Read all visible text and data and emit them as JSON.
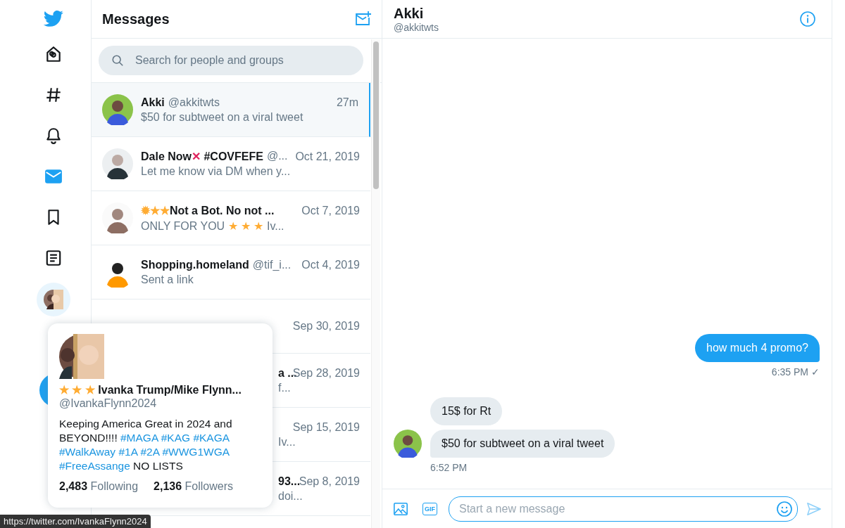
{
  "nav": {
    "items": [
      {
        "selected": false
      },
      {
        "selected": false
      },
      {
        "selected": false
      },
      {
        "selected": true
      },
      {
        "selected": false
      },
      {
        "selected": false
      }
    ]
  },
  "messages_panel": {
    "title": "Messages",
    "search": {
      "placeholder": "Search for people and groups"
    },
    "conversations": [
      {
        "kind": "full",
        "selected": true,
        "name": [
          {
            "text": "Akki"
          }
        ],
        "handle": "@akkitwts",
        "date": "27m",
        "preview": [
          {
            "text": "$50 for subtweet on a viral tweet"
          }
        ]
      },
      {
        "kind": "full",
        "selected": false,
        "name": [
          {
            "text": "Dale Now"
          },
          {
            "text": "✕",
            "color": "#e0245e"
          },
          {
            "text": " #COVFEFE"
          }
        ],
        "handle": "@...",
        "date": "Oct 21, 2019",
        "preview": [
          {
            "text": "Let me know via DM when y..."
          }
        ]
      },
      {
        "kind": "full",
        "selected": false,
        "name": [
          {
            "text": "✹★★",
            "color": "#ffac33"
          },
          {
            "text": "Not a Bot. No not ..."
          }
        ],
        "date": "Oct 7, 2019",
        "preview": [
          {
            "text": "ONLY FOR YOU "
          },
          {
            "text": "★ ★ ★",
            "color": "#ffac33"
          },
          {
            "text": " Iv..."
          }
        ]
      },
      {
        "kind": "full",
        "selected": false,
        "name": [
          {
            "text": "Shopping.homeland"
          }
        ],
        "handle": "@tif_i...",
        "date": "Oct 4, 2019",
        "preview": [
          {
            "text": "Sent a link"
          }
        ]
      },
      {
        "kind": "covered",
        "selected": false,
        "date": "Sep 30, 2019"
      },
      {
        "kind": "covered",
        "selected": false,
        "name": [
          {
            "text": "a ..."
          }
        ],
        "date": "Sep 28, 2019",
        "preview": [
          {
            "text": "f..."
          }
        ]
      },
      {
        "kind": "covered",
        "selected": false,
        "date": "Sep 15, 2019",
        "preview": [
          {
            "text": "Iv..."
          }
        ]
      },
      {
        "kind": "covered",
        "selected": false,
        "name": [
          {
            "text": "93..."
          }
        ],
        "date": "Sep 8, 2019",
        "preview": [
          {
            "text": "doi..."
          }
        ]
      }
    ]
  },
  "conversation": {
    "name": "Akki",
    "handle": "@akkitwts",
    "messages": [
      {
        "kind": "outgoing",
        "bubbles": [
          "how much 4 promo?"
        ],
        "time": "6:35 PM",
        "read_mark": "✓"
      },
      {
        "kind": "incoming",
        "bubbles": [
          "15$ for Rt",
          "$50 for subtweet on a viral tweet"
        ],
        "time": "6:52 PM"
      }
    ],
    "composer": {
      "gif_label": "GIF",
      "placeholder": "Start a new message"
    }
  },
  "profile_card": {
    "name": [
      {
        "text": "★ ★ ★",
        "color": "#ffac33"
      },
      {
        "text": " Ivanka Trump/Mike Flynn..."
      }
    ],
    "handle": "@IvankaFlynn2024",
    "bio": [
      {
        "kind": "text",
        "text": "Keeping America Great in 2024 and BEYOND!!!! "
      },
      {
        "kind": "hashtag",
        "text": "#MAGA #KAG #KAGA #WalkAway #1A #2A #WWG1WGA #FreeAssange"
      },
      {
        "kind": "text",
        "text": " NO LISTS"
      }
    ],
    "following": {
      "count": "2,483",
      "label": "Following"
    },
    "followers": {
      "count": "2,136",
      "label": "Followers"
    }
  },
  "status_url": "https://twitter.com/IvankaFlynn2024"
}
